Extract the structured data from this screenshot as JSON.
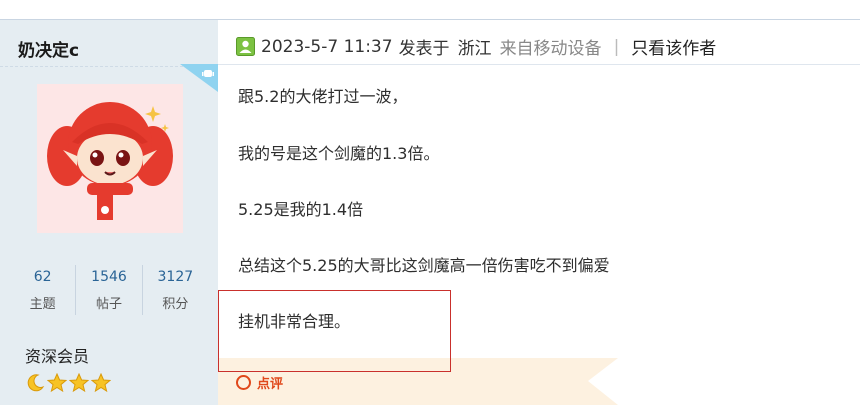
{
  "author": {
    "username": "奶决定c",
    "stats": [
      {
        "value": "62",
        "label": "主题"
      },
      {
        "value": "1546",
        "label": "帖子"
      },
      {
        "value": "3127",
        "label": "积分"
      }
    ],
    "rank": "资深会员",
    "rank_icons": [
      "moon-icon",
      "star-icon",
      "star-icon",
      "star-icon"
    ]
  },
  "post": {
    "date": "2023-5-7 11:37",
    "posted_label": "发表于",
    "location": "浙江",
    "device": "来自移动设备",
    "separator": "|",
    "only_author_link": "只看该作者",
    "lines": [
      "跟5.2的大佬打过一波，",
      "我的号是这个剑魔的1.3倍。",
      "5.25是我的1.4倍",
      "总结这个5.25的大哥比这剑魔高一倍伤害吃不到偏爱",
      "挂机非常合理。"
    ],
    "comment_button": "点评"
  },
  "colors": {
    "sidebar_bg": "#e5edf2",
    "comment_red": "#e0481b",
    "highlight_border": "#c9302c"
  }
}
